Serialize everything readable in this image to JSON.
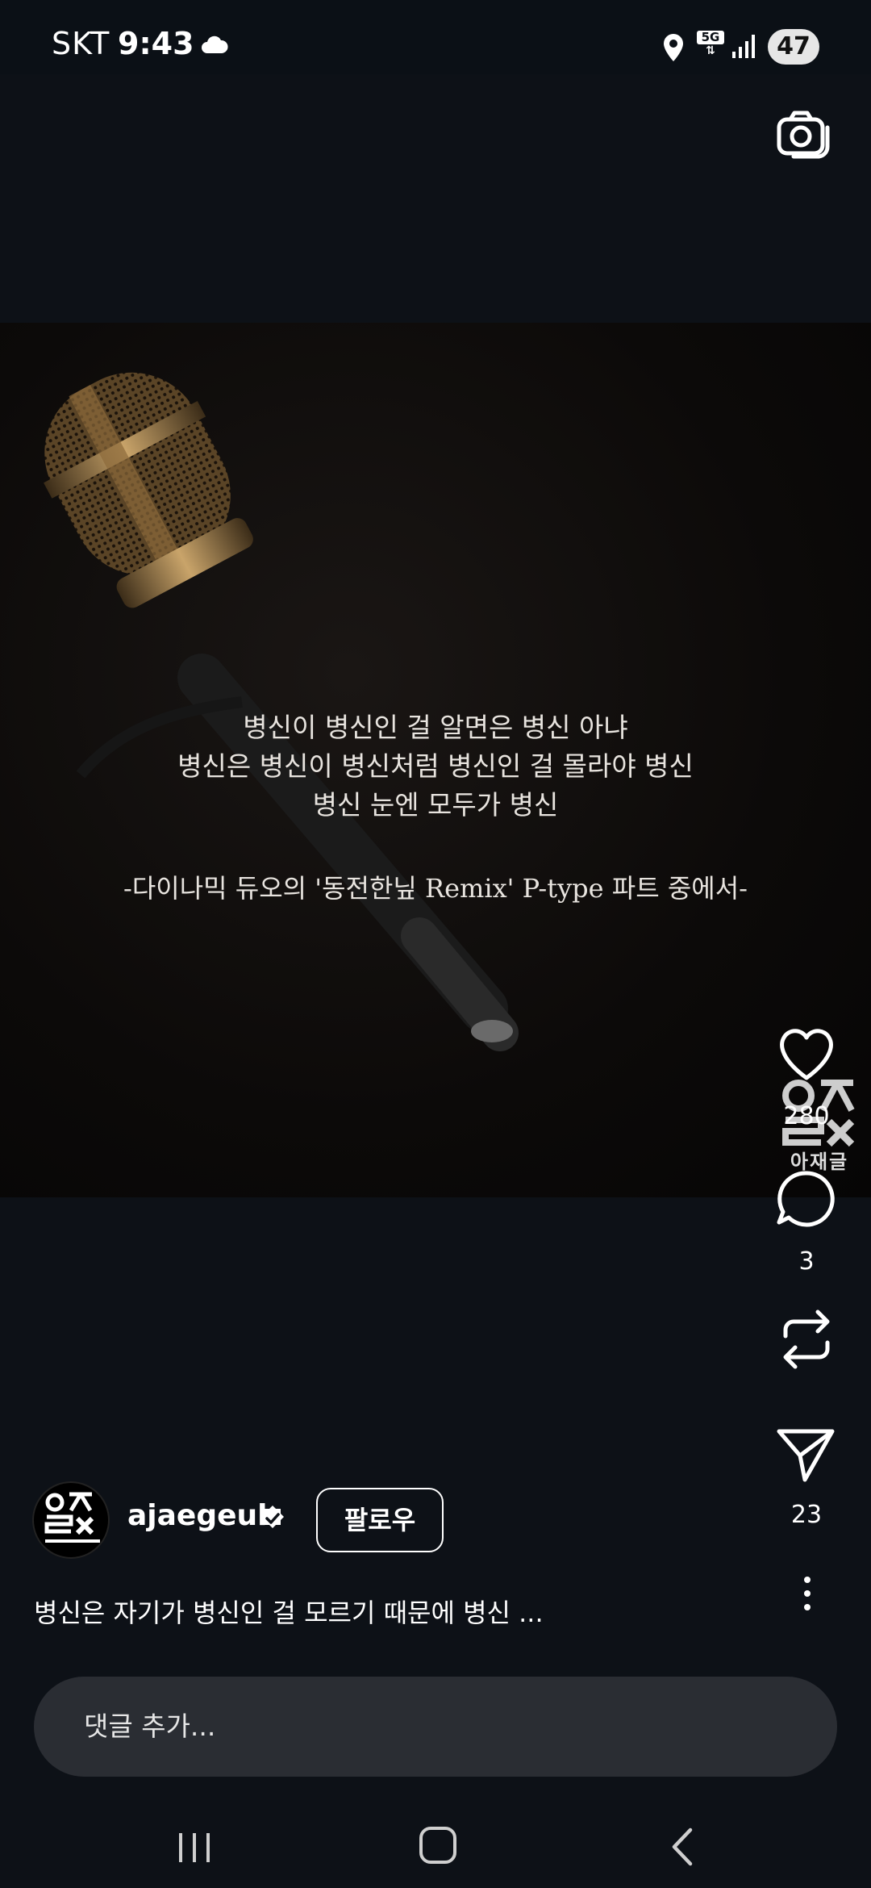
{
  "status_bar": {
    "carrier": "SKT",
    "time": "9:43",
    "network": "5G",
    "battery": "47"
  },
  "post": {
    "quote_lines": [
      "병신이 병신인 걸 알면은 병신 아냐",
      "병신은 병신이 병신처럼 병신인 걸 몰라야 병신",
      "병신 눈엔 모두가 병신"
    ],
    "quote_source": "-다이나믹 듀오의 '동전한닢 Remix' P-type 파트 중에서-"
  },
  "actions": {
    "likes": "280",
    "comments": "3",
    "shares": "23"
  },
  "watermark": {
    "text": "아재글"
  },
  "author": {
    "username": "ajaegeul",
    "follow_label": "팔로우",
    "verified": true
  },
  "caption": "병신은 자기가 병신인 걸 모르기 때문에 병신 ...",
  "comment": {
    "placeholder": "댓글 추가..."
  },
  "icons": {
    "cloud": "cloud-icon",
    "location": "location-icon",
    "signal": "signal-icon",
    "camera": "camera-icon",
    "like": "heart-icon",
    "comment": "comment-icon",
    "repost": "repost-icon",
    "share": "send-icon",
    "more": "more-icon"
  }
}
